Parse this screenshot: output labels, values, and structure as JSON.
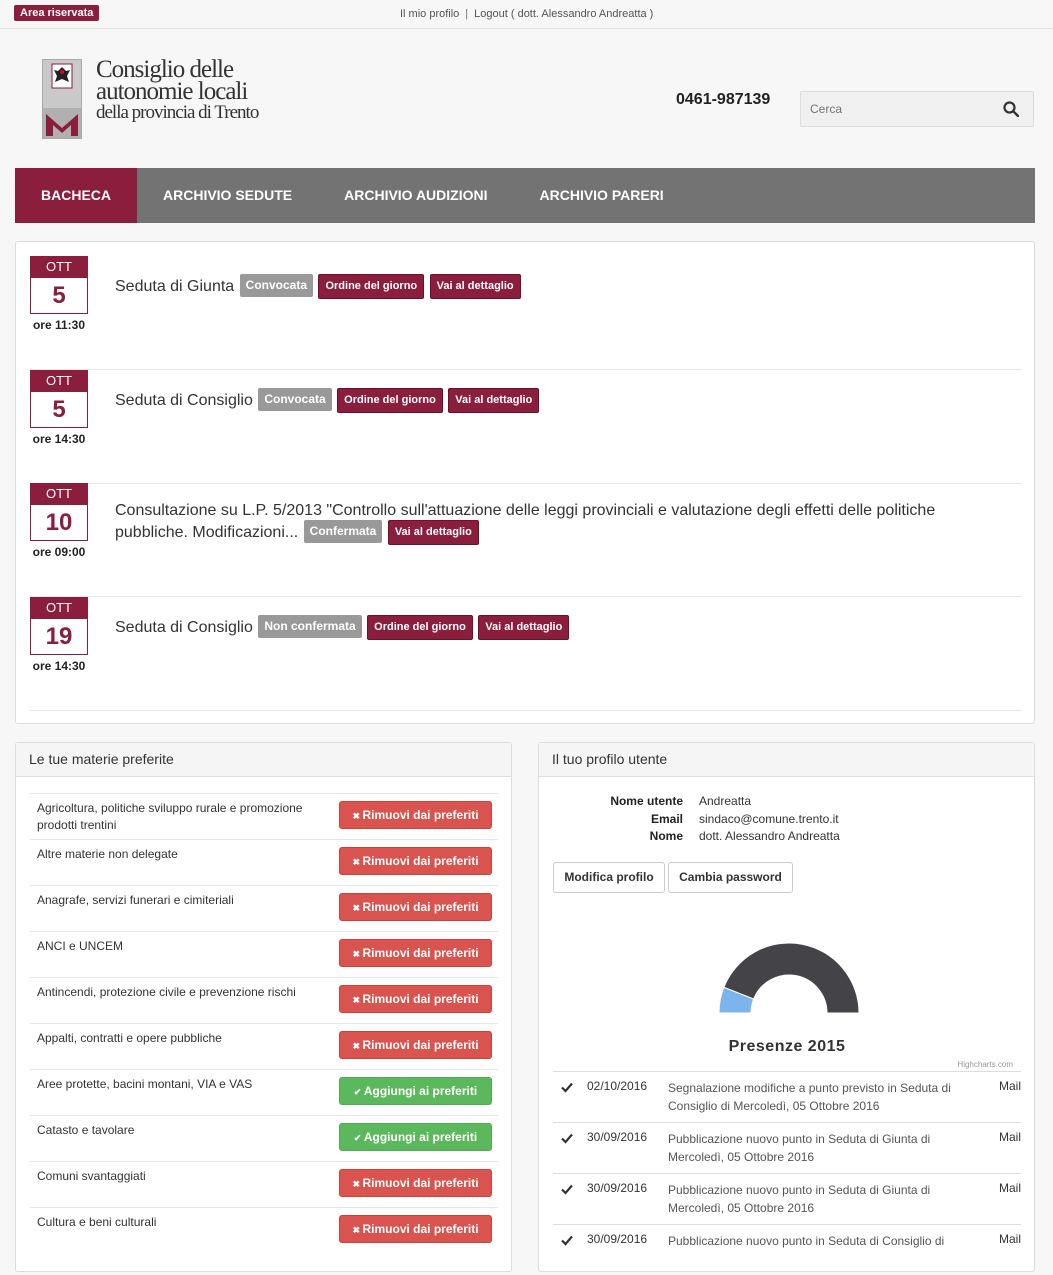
{
  "topbar": {
    "area_label": "Area riservata",
    "profile_link": "Il mio profilo",
    "separator": "|",
    "logout_link": "Logout ( dott. Alessandro Andreatta )"
  },
  "header": {
    "logo_line1": "Consiglio delle",
    "logo_line2": "autonomie locali",
    "logo_line3": "della provincia di Trento",
    "phone": "0461-987139",
    "search_placeholder": "Cerca"
  },
  "nav": {
    "items": [
      "BACHECA",
      "ARCHIVIO SEDUTE",
      "ARCHIVIO AUDIZIONI",
      "ARCHIVIO PARERI"
    ]
  },
  "events": [
    {
      "month": "OTT",
      "day": "5",
      "time": "ore 11:30",
      "title": "Seduta di Giunta",
      "status": "Convocata",
      "odg": "Ordine del giorno",
      "detail": "Vai al dettaglio"
    },
    {
      "month": "OTT",
      "day": "5",
      "time": "ore 14:30",
      "title": "Seduta di Consiglio",
      "status": "Convocata",
      "odg": "Ordine del giorno",
      "detail": "Vai al dettaglio"
    },
    {
      "month": "OTT",
      "day": "10",
      "time": "ore 09:00",
      "title": "Consultazione su L.P. 5/2013 \"Controllo sull'attuazione delle leggi provinciali e valutazione degli effetti delle politiche pubbliche. Modificazioni...",
      "status": "Confermata",
      "detail": "Vai al dettaglio"
    },
    {
      "month": "OTT",
      "day": "19",
      "time": "ore 14:30",
      "title": "Seduta di Consiglio",
      "status": "Non confermata",
      "odg": "Ordine del giorno",
      "detail": "Vai al dettaglio"
    }
  ],
  "materie": {
    "title": "Le tue materie preferite",
    "items": [
      {
        "label": "Agricoltura, politiche sviluppo rurale e promozione prodotti trentini",
        "action": "Rimuovi dai preferiti",
        "kind": "remove"
      },
      {
        "label": "Altre materie non delegate",
        "action": "Rimuovi dai preferiti",
        "kind": "remove"
      },
      {
        "label": "Anagrafe, servizi funerari e cimiteriali",
        "action": "Rimuovi dai preferiti",
        "kind": "remove"
      },
      {
        "label": "ANCI e UNCEM",
        "action": "Rimuovi dai preferiti",
        "kind": "remove"
      },
      {
        "label": "Antincendi, protezione civile e prevenzione rischi",
        "action": "Rimuovi dai preferiti",
        "kind": "remove"
      },
      {
        "label": "Appalti, contratti e opere pubbliche",
        "action": "Rimuovi dai preferiti",
        "kind": "remove"
      },
      {
        "label": "Aree protette, bacini montani, VIA e VAS",
        "action": "Aggiungi ai preferiti",
        "kind": "add"
      },
      {
        "label": "Catasto e tavolare",
        "action": "Aggiungi ai preferiti",
        "kind": "add"
      },
      {
        "label": "Comuni svantaggiati",
        "action": "Rimuovi dai preferiti",
        "kind": "remove"
      },
      {
        "label": "Cultura e beni culturali",
        "action": "Rimuovi dai preferiti",
        "kind": "remove"
      }
    ]
  },
  "profile": {
    "title": "Il tuo profilo utente",
    "fields": [
      {
        "key": "Nome utente",
        "value": "Andreatta"
      },
      {
        "key": "Email",
        "value": "sindaco@comune.trento.it"
      },
      {
        "key": "Nome",
        "value": "dott. Alessandro Andreatta"
      }
    ],
    "edit_button": "Modifica profilo",
    "password_button": "Cambia password",
    "chart_title": "Presenze 2015",
    "chart_credits": "Highcharts.com",
    "notifications": [
      {
        "date": "02/10/2016",
        "text": "Segnalazione modifiche a punto previsto in Seduta di Consiglio di Mercoledì, 05 Ottobre 2016",
        "type": "Mail"
      },
      {
        "date": "30/09/2016",
        "text": "Pubblicazione nuovo punto in Seduta di Giunta di Mercoledì, 05 Ottobre 2016",
        "type": "Mail"
      },
      {
        "date": "30/09/2016",
        "text": "Pubblicazione nuovo punto in Seduta di Giunta di Mercoledì, 05 Ottobre 2016",
        "type": "Mail"
      },
      {
        "date": "30/09/2016",
        "text": "Pubblicazione nuovo punto in Seduta di Consiglio di",
        "type": "Mail"
      }
    ]
  },
  "chart_data": {
    "type": "pie",
    "title": "Presenze 2015",
    "slices": [
      {
        "value": 0.12,
        "color": "#7cb5ec"
      },
      {
        "value": 0.88,
        "color": "#434348"
      }
    ]
  },
  "colors": {
    "brand": "#8b1d3d",
    "nav_bg": "#737373",
    "remove": "#d9534f",
    "add": "#5cb85c",
    "status_grey": "#999999"
  }
}
